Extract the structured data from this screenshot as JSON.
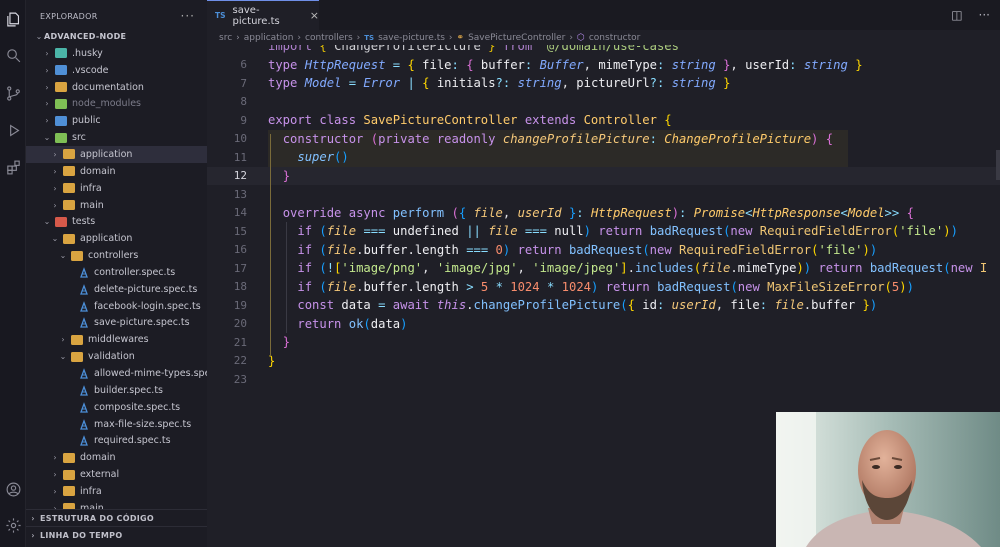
{
  "sidebar": {
    "title": "EXPLORADOR",
    "more": "···",
    "items": [
      {
        "label": "ADVANCED-NODE",
        "indent": 0,
        "chev": "⌄",
        "kind": "root"
      },
      {
        "label": ".husky",
        "indent": 1,
        "chev": "›",
        "kind": "folder",
        "color": "teal"
      },
      {
        "label": ".vscode",
        "indent": 1,
        "chev": "›",
        "kind": "folder",
        "color": "blue"
      },
      {
        "label": "documentation",
        "indent": 1,
        "chev": "›",
        "kind": "folder",
        "color": "yellow"
      },
      {
        "label": "node_modules",
        "indent": 1,
        "chev": "›",
        "kind": "folder",
        "color": "green",
        "dim": true
      },
      {
        "label": "public",
        "indent": 1,
        "chev": "›",
        "kind": "folder",
        "color": "blue"
      },
      {
        "label": "src",
        "indent": 1,
        "chev": "⌄",
        "kind": "folder",
        "color": "green"
      },
      {
        "label": "application",
        "indent": 2,
        "chev": "›",
        "kind": "folder",
        "color": "yellow",
        "selected": true
      },
      {
        "label": "domain",
        "indent": 2,
        "chev": "›",
        "kind": "folder",
        "color": "yellow"
      },
      {
        "label": "infra",
        "indent": 2,
        "chev": "›",
        "kind": "folder",
        "color": "yellow"
      },
      {
        "label": "main",
        "indent": 2,
        "chev": "›",
        "kind": "folder",
        "color": "yellow"
      },
      {
        "label": "tests",
        "indent": 1,
        "chev": "⌄",
        "kind": "folder",
        "color": "red"
      },
      {
        "label": "application",
        "indent": 2,
        "chev": "⌄",
        "kind": "folder",
        "color": "yellow"
      },
      {
        "label": "controllers",
        "indent": 3,
        "chev": "⌄",
        "kind": "folder",
        "color": "yellow"
      },
      {
        "label": "controller.spec.ts",
        "indent": 4,
        "chev": "",
        "kind": "spec"
      },
      {
        "label": "delete-picture.spec.ts",
        "indent": 4,
        "chev": "",
        "kind": "spec"
      },
      {
        "label": "facebook-login.spec.ts",
        "indent": 4,
        "chev": "",
        "kind": "spec"
      },
      {
        "label": "save-picture.spec.ts",
        "indent": 4,
        "chev": "",
        "kind": "spec"
      },
      {
        "label": "middlewares",
        "indent": 3,
        "chev": "›",
        "kind": "folder",
        "color": "yellow"
      },
      {
        "label": "validation",
        "indent": 3,
        "chev": "⌄",
        "kind": "folder",
        "color": "yellow"
      },
      {
        "label": "allowed-mime-types.spe...",
        "indent": 4,
        "chev": "",
        "kind": "spec"
      },
      {
        "label": "builder.spec.ts",
        "indent": 4,
        "chev": "",
        "kind": "spec"
      },
      {
        "label": "composite.spec.ts",
        "indent": 4,
        "chev": "",
        "kind": "spec"
      },
      {
        "label": "max-file-size.spec.ts",
        "indent": 4,
        "chev": "",
        "kind": "spec"
      },
      {
        "label": "required.spec.ts",
        "indent": 4,
        "chev": "",
        "kind": "spec"
      },
      {
        "label": "domain",
        "indent": 2,
        "chev": "›",
        "kind": "folder",
        "color": "yellow"
      },
      {
        "label": "external",
        "indent": 2,
        "chev": "›",
        "kind": "folder",
        "color": "yellow"
      },
      {
        "label": "infra",
        "indent": 2,
        "chev": "›",
        "kind": "folder",
        "color": "yellow"
      },
      {
        "label": "main",
        "indent": 2,
        "chev": "›",
        "kind": "folder",
        "color": "yellow"
      }
    ],
    "sections": [
      "ESTRUTURA DO CÓDIGO",
      "LINHA DO TEMPO"
    ]
  },
  "tab": {
    "badge": "TS",
    "label": "save-picture.ts",
    "close": "×"
  },
  "breadcrumbs": {
    "parts": [
      "src",
      "application",
      "controllers"
    ],
    "file_badge": "TS",
    "file": "save-picture.ts",
    "class_name": "SavePictureController",
    "member": "constructor"
  },
  "editor": {
    "current_line": 12,
    "lines": [
      {
        "n": "",
        "html": "<span class='k'>import</span> <span class='br1'>{</span> <span class='var'>ChangeProfilePicture</span> <span class='br1'>}</span> <span class='k'>from</span> <span class='s'>'@/domain/use-cases'</span>",
        "partial": true
      },
      {
        "n": "6",
        "html": "<span class='k'>type</span> <span class='t'>HttpRequest</span> <span class='op'>=</span> <span class='br1'>{</span> <span class='var'>file</span><span class='op'>:</span> <span class='br2'>{</span> <span class='var'>buffer</span><span class='op'>:</span> <span class='t'>Buffer</span>, <span class='var'>mimeType</span><span class='op'>:</span> <span class='t'>string</span> <span class='br2'>}</span>, <span class='var'>userId</span><span class='op'>:</span> <span class='t'>string</span> <span class='br1'>}</span>"
      },
      {
        "n": "7",
        "html": "<span class='k'>type</span> <span class='t'>Model</span> <span class='op'>=</span> <span class='t'>Error</span> <span class='op'>|</span> <span class='br1'>{</span> <span class='var'>initials</span><span class='op'>?:</span> <span class='t'>string</span>, <span class='var'>pictureUrl</span><span class='op'>?:</span> <span class='t'>string</span> <span class='br1'>}</span>"
      },
      {
        "n": "8",
        "html": ""
      },
      {
        "n": "9",
        "html": "<span class='k'>export</span> <span class='k'>class</span> <span class='cls'>SavePictureController</span> <span class='k'>extends</span> <span class='cls'>Controller</span> <span class='br1'>{</span>"
      },
      {
        "n": "10",
        "html": "  <span class='k'>constructor</span> <span class='br2'>(</span><span class='k'>private</span> <span class='k'>readonly</span> <span class='pi'>changeProfilePicture</span><span class='op'>:</span> <span class='tp'>ChangeProfilePicture</span><span class='br2'>)</span> <span class='br2'>{</span>"
      },
      {
        "n": "11",
        "html": "    <span class='fn ital'>super</span><span class='br3'>()</span>"
      },
      {
        "n": "12",
        "html": "  <span class='br2'>}</span>"
      },
      {
        "n": "13",
        "html": ""
      },
      {
        "n": "14",
        "html": "  <span class='k'>override</span> <span class='k'>async</span> <span class='fn'>perform</span> <span class='br2'>(</span><span class='br3'>{</span> <span class='pi'>file</span>, <span class='pi'>userId</span> <span class='br3'>}</span><span class='op'>:</span> <span class='tp'>HttpRequest</span><span class='br2'>)</span><span class='op'>:</span> <span class='tp'>Promise</span><span class='op'>&lt;</span><span class='tp'>HttpResponse</span><span class='op'>&lt;</span><span class='tp'>Model</span><span class='op'>&gt;&gt;</span> <span class='br2'>{</span>"
      },
      {
        "n": "15",
        "html": "    <span class='k'>if</span> <span class='br3'>(</span><span class='pi'>file</span> <span class='op'>===</span> <span class='var'>undefined</span> <span class='op'>||</span> <span class='pi'>file</span> <span class='op'>===</span> <span class='var'>null</span><span class='br3'>)</span> <span class='k'>return</span> <span class='fn'>badRequest</span><span class='br3'>(</span><span class='k'>new</span> <span class='cl2'>RequiredFieldError</span><span class='br1'>(</span><span class='s'>'file'</span><span class='br1'>)</span><span class='br3'>)</span>"
      },
      {
        "n": "16",
        "html": "    <span class='k'>if</span> <span class='br3'>(</span><span class='pi'>file</span>.<span class='var'>buffer</span>.<span class='var'>length</span> <span class='op'>===</span> <span class='n'>0</span><span class='br3'>)</span> <span class='k'>return</span> <span class='fn'>badRequest</span><span class='br3'>(</span><span class='k'>new</span> <span class='cl2'>RequiredFieldError</span><span class='br1'>(</span><span class='s'>'file'</span><span class='br1'>)</span><span class='br3'>)</span>"
      },
      {
        "n": "17",
        "html": "    <span class='k'>if</span> <span class='br3'>(</span><span class='op'>!</span><span class='br1'>[</span><span class='s'>'image/png'</span>, <span class='s'>'image/jpg'</span>, <span class='s'>'image/jpeg'</span><span class='br1'>]</span>.<span class='fn'>includes</span><span class='br1'>(</span><span class='pi'>file</span>.<span class='var'>mimeType</span><span class='br1'>)</span><span class='br3'>)</span> <span class='k'>return</span> <span class='fn'>badRequest</span><span class='br3'>(</span><span class='k'>new</span> <span class='cl2'>I</span>"
      },
      {
        "n": "18",
        "html": "    <span class='k'>if</span> <span class='br3'>(</span><span class='pi'>file</span>.<span class='var'>buffer</span>.<span class='var'>length</span> <span class='op'>&gt;</span> <span class='n'>5</span> <span class='op'>*</span> <span class='n'>1024</span> <span class='op'>*</span> <span class='n'>1024</span><span class='br3'>)</span> <span class='k'>return</span> <span class='fn'>badRequest</span><span class='br3'>(</span><span class='k'>new</span> <span class='cl2'>MaxFileSizeError</span><span class='br1'>(</span><span class='n'>5</span><span class='br1'>)</span><span class='br3'>)</span>"
      },
      {
        "n": "19",
        "html": "    <span class='k'>const</span> <span class='var'>data</span> <span class='op'>=</span> <span class='k'>await</span> <span class='k ital'>this</span>.<span class='fn'>changeProfilePicture</span><span class='br3'>(</span><span class='br1'>{</span> <span class='var'>id</span><span class='op'>:</span> <span class='pi'>userId</span>, <span class='var'>file</span><span class='op'>:</span> <span class='pi'>file</span>.<span class='var'>buffer</span> <span class='br1'>}</span><span class='br3'>)</span>"
      },
      {
        "n": "20",
        "html": "    <span class='k'>return</span> <span class='fn'>ok</span><span class='br3'>(</span><span class='var'>data</span><span class='br3'>)</span>"
      },
      {
        "n": "21",
        "html": "  <span class='br2'>}</span>"
      },
      {
        "n": "22",
        "html": "<span class='br1'>}</span>"
      },
      {
        "n": "23",
        "html": ""
      }
    ]
  }
}
